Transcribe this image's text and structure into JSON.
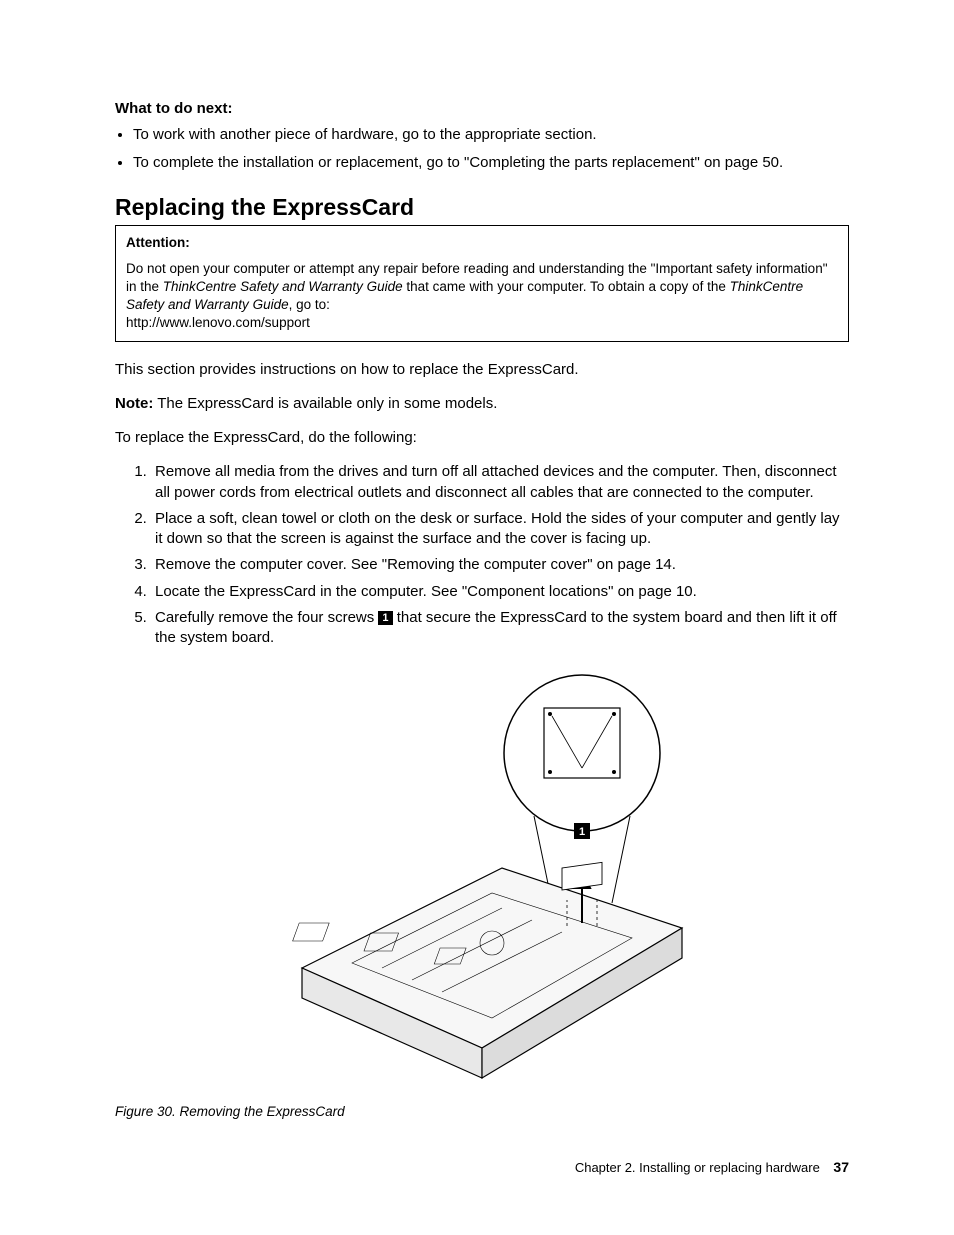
{
  "what_next_heading": "What to do next:",
  "what_next_bullets": [
    "To work with another piece of hardware, go to the appropriate section.",
    "To complete the installation or replacement, go to \"Completing the parts replacement\" on page 50."
  ],
  "section_heading": "Replacing the ExpressCard",
  "attention": {
    "heading": "Attention:",
    "line1_pre": "Do not open your computer or attempt any repair before reading and understanding the \"Important safety information\" in the ",
    "line1_em1": "ThinkCentre Safety and Warranty Guide",
    "line1_mid": " that came with your computer. To obtain a copy of the ",
    "line1_em2": "ThinkCentre Safety and Warranty Guide",
    "line1_post": ", go to:",
    "url": "http://www.lenovo.com/support"
  },
  "intro_para": "This section provides instructions on how to replace the ExpressCard.",
  "note_label": "Note:",
  "note_text": " The ExpressCard is available only in some models.",
  "lead_in": "To replace the ExpressCard, do the following:",
  "steps": [
    "Remove all media from the drives and turn off all attached devices and the computer. Then, disconnect all power cords from electrical outlets and disconnect all cables that are connected to the computer.",
    "Place a soft, clean towel or cloth on the desk or surface. Hold the sides of your computer and gently lay it down so that the screen is against the surface and the cover is facing up.",
    "Remove the computer cover. See \"Removing the computer cover\" on page 14.",
    "Locate the ExpressCard in the computer. See \"Component locations\" on page 10."
  ],
  "step5_pre": "Carefully remove the four screws ",
  "step5_callout": "1",
  "step5_post": " that secure the ExpressCard to the system board and then lift it off the system board.",
  "figure_callout": "1",
  "figure_caption": "Figure 30.  Removing the ExpressCard",
  "footer_chapter": "Chapter 2.  Installing or replacing hardware",
  "footer_page": "37"
}
